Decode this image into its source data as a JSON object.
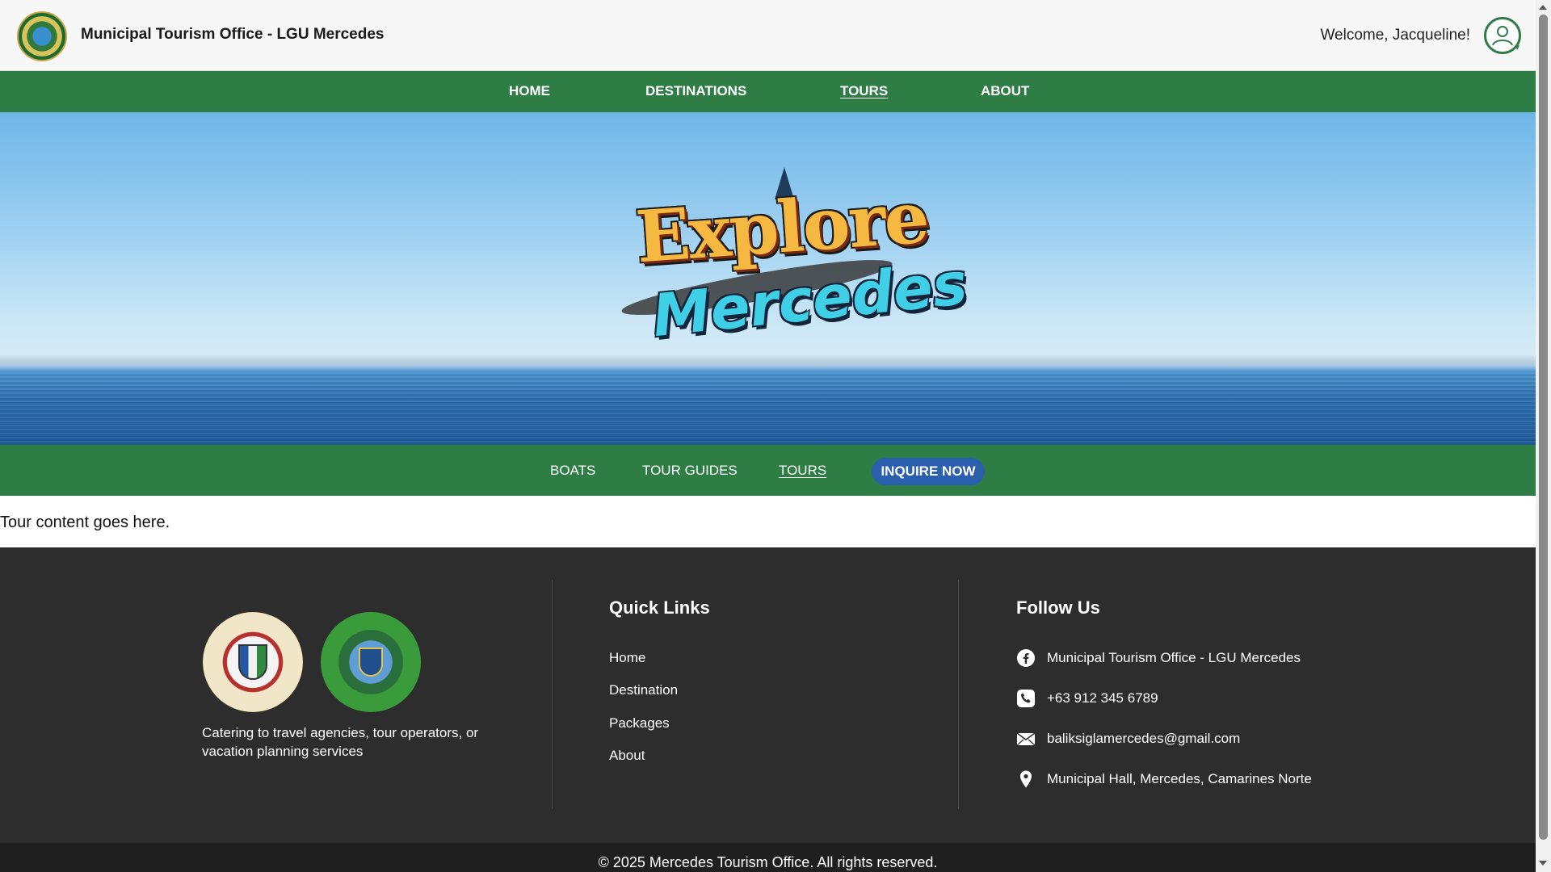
{
  "header": {
    "title": "Municipal Tourism Office - LGU Mercedes",
    "welcome": "Welcome, Jacqueline!"
  },
  "main_nav": {
    "items": [
      {
        "label": "HOME",
        "active": false
      },
      {
        "label": "DESTINATIONS",
        "active": false
      },
      {
        "label": "TOURS",
        "active": true
      },
      {
        "label": "ABOUT",
        "active": false
      }
    ]
  },
  "hero": {
    "logo_line1": "Explore",
    "logo_line2": "Mercedes"
  },
  "sub_nav": {
    "items": [
      {
        "label": "BOATS",
        "active": false
      },
      {
        "label": "TOUR GUIDES",
        "active": false
      },
      {
        "label": "TOURS",
        "active": true
      }
    ],
    "cta": "INQUIRE NOW"
  },
  "content": {
    "text": "Tour content goes here."
  },
  "footer": {
    "tagline": "Catering to travel agencies, tour operators, or vacation planning services",
    "quick_links": {
      "title": "Quick Links",
      "items": [
        "Home",
        "Destination",
        "Packages",
        "About"
      ]
    },
    "follow_us": {
      "title": "Follow Us",
      "items": [
        {
          "icon": "facebook-icon",
          "text": "Municipal Tourism Office - LGU Mercedes"
        },
        {
          "icon": "phone-icon",
          "text": "+63 912 345 6789"
        },
        {
          "icon": "mail-icon",
          "text": "baliksiglamercedes@gmail.com"
        },
        {
          "icon": "location-pin-icon",
          "text": "Municipal Hall, Mercedes, Camarines Norte"
        }
      ]
    },
    "copyright": "© 2025 Mercedes Tourism Office. All rights reserved."
  },
  "colors": {
    "nav_green": "#2e7d45",
    "cta_blue": "#2a5fae",
    "footer_bg": "#2d2d2d"
  }
}
